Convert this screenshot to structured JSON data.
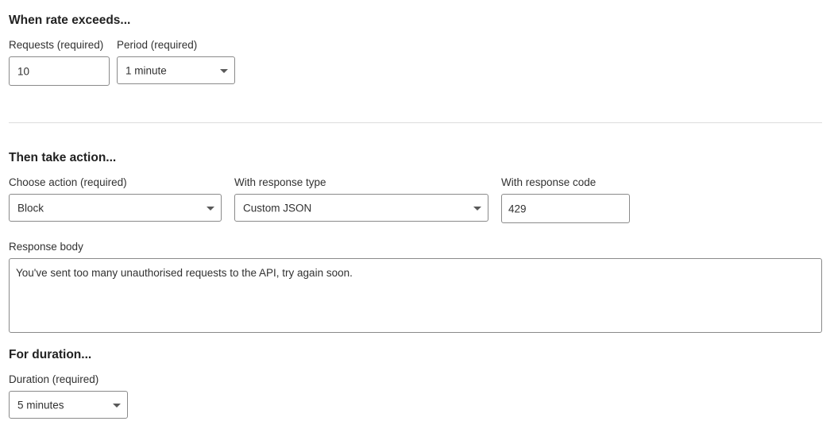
{
  "rate_section": {
    "heading": "When rate exceeds...",
    "requests_label": "Requests (required)",
    "requests_value": "10",
    "period_label": "Period (required)",
    "period_value": "1 minute"
  },
  "action_section": {
    "heading": "Then take action...",
    "action_label": "Choose action (required)",
    "action_value": "Block",
    "response_type_label": "With response type",
    "response_type_value": "Custom JSON",
    "response_code_label": "With response code",
    "response_code_value": "429",
    "response_body_label": "Response body",
    "response_body_value": "You've sent too many unauthorised requests to the API, try again soon."
  },
  "duration_section": {
    "heading": "For duration...",
    "duration_label": "Duration (required)",
    "duration_value": "5 minutes"
  },
  "icons": {
    "dropdown": "chevron-down-icon"
  }
}
